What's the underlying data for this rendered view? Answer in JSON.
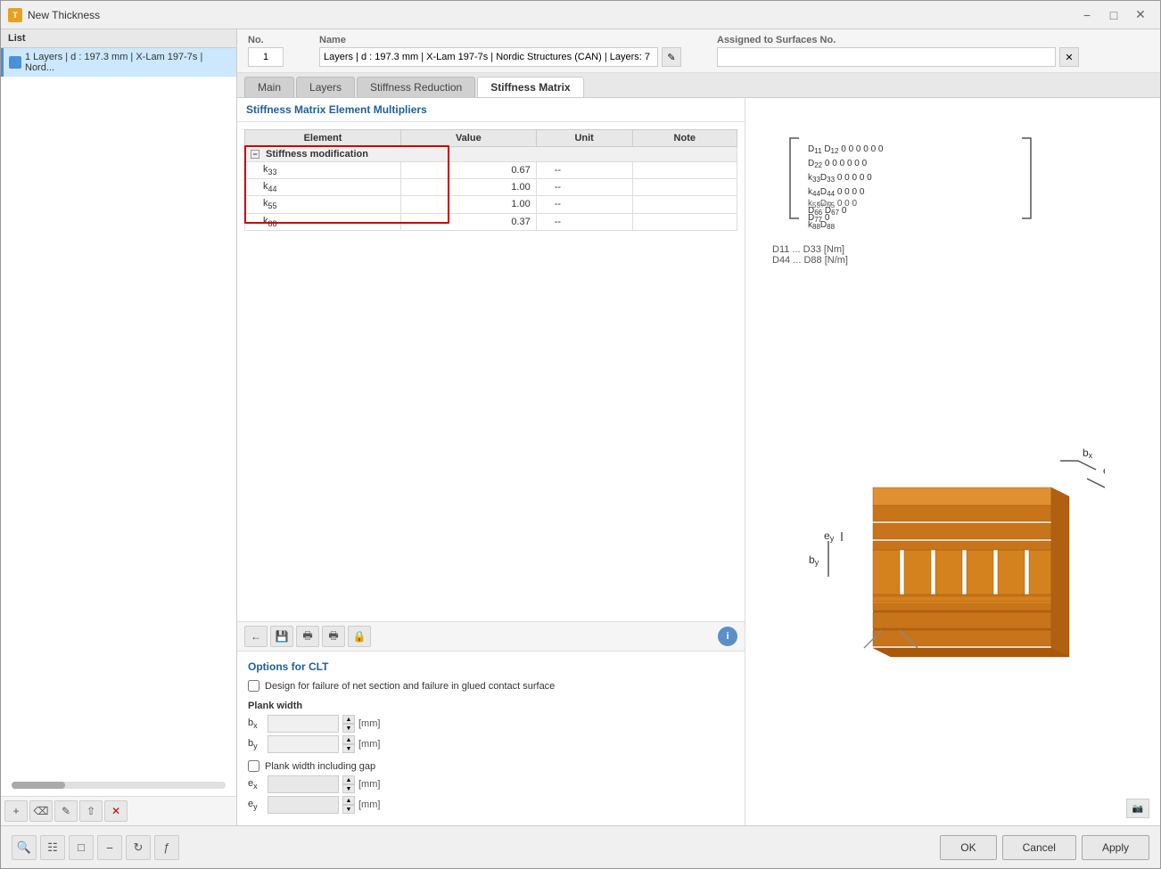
{
  "window": {
    "title": "New Thickness",
    "icon": "T"
  },
  "header": {
    "no_label": "No.",
    "no_value": "1",
    "name_label": "Name",
    "name_value": "Layers | d : 197.3 mm | X-Lam 197-7s | Nordic Structures (CAN) | Layers: 7",
    "surfaces_label": "Assigned to Surfaces No."
  },
  "tabs": {
    "items": [
      "Main",
      "Layers",
      "Stiffness Reduction",
      "Stiffness Matrix"
    ],
    "active": "Stiffness Matrix"
  },
  "stiffness_matrix": {
    "section_title": "Stiffness Matrix Element Multipliers",
    "columns": [
      "Element",
      "Value",
      "Unit",
      "Note"
    ],
    "group": {
      "label": "Stiffness modification",
      "rows": [
        {
          "name": "k33",
          "sub": "33",
          "value": "0.67",
          "unit": "--",
          "note": ""
        },
        {
          "name": "k44",
          "sub": "44",
          "value": "1.00",
          "unit": "--",
          "note": ""
        },
        {
          "name": "k55",
          "sub": "55",
          "value": "1.00",
          "unit": "--",
          "note": ""
        },
        {
          "name": "k88",
          "sub": "88",
          "value": "0.37",
          "unit": "--",
          "note": ""
        }
      ]
    }
  },
  "toolbar_buttons": {
    "btn1": "⬅",
    "btn2": "📋",
    "btn3": "🖨",
    "btn4": "🖨",
    "btn5": "🔒"
  },
  "clt_options": {
    "title": "Options for CLT",
    "checkbox1_label": "Design for failure of net section and failure in glued contact surface",
    "checkbox1_checked": false,
    "plank_width_title": "Plank width",
    "bx_label": "bx",
    "bx_unit": "[mm]",
    "by_label": "by",
    "by_unit": "[mm]",
    "checkbox2_label": "Plank width including gap",
    "checkbox2_checked": false,
    "ex_label": "ex",
    "ex_unit": "[mm]",
    "ey_label": "ey",
    "ey_unit": "[mm]"
  },
  "matrix_legend": {
    "line1": "D11 ... D33 [Nm]",
    "line2": "D44 ... D88 [N/m]"
  },
  "list": {
    "header": "List",
    "item": "1   Layers | d : 197.3 mm | X-Lam 197-7s | Nord..."
  },
  "bottom_buttons": {
    "ok": "OK",
    "cancel": "Cancel",
    "apply": "Apply"
  }
}
